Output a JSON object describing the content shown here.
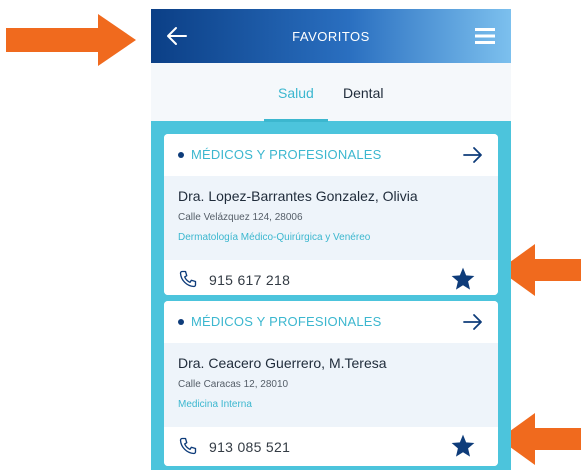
{
  "header": {
    "title": "FAVORITOS",
    "back_icon": "arrow-left-icon",
    "menu_icon": "hamburger-menu-icon"
  },
  "tabs": [
    {
      "label": "Salud",
      "active": true
    },
    {
      "label": "Dental",
      "active": false
    }
  ],
  "cards": [
    {
      "category": "MÉDICOS Y PROFESIONALES",
      "name": "Dra. Lopez-Barrantes Gonzalez, Olivia",
      "address": "Calle Velázquez 124, 28006",
      "specialty": "Dermatología Médico-Quirúrgica y Venéreo",
      "phone": "915 617 218",
      "favorite": true
    },
    {
      "category": "MÉDICOS Y PROFESIONALES",
      "name": "Dra. Ceacero Guerrero, M.Teresa",
      "address": "Calle Caracas 12, 28010",
      "specialty": "Medicina Interna",
      "phone": "913 085 521",
      "favorite": true
    }
  ],
  "colors": {
    "accent": "#3cb7cf",
    "header_dark": "#0b3f86",
    "header_light": "#7cc0ee",
    "list_background": "#4cc4dc",
    "star": "#0e3c7a",
    "annotation_arrow": "#f06a1e"
  }
}
